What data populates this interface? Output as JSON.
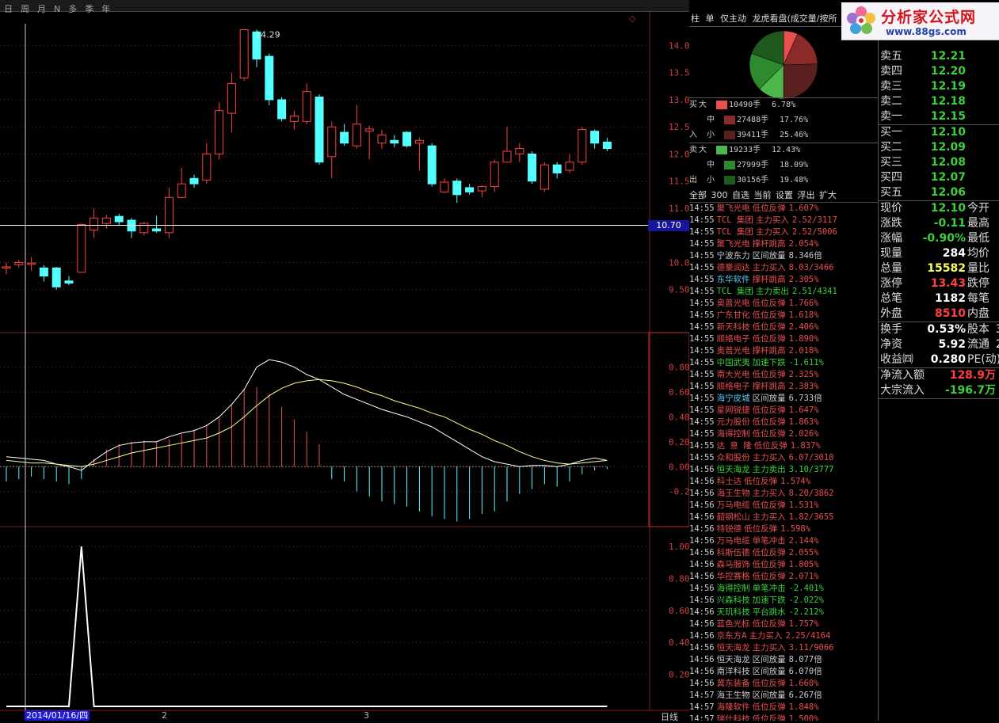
{
  "toolbar": {
    "items": [
      "日",
      "周",
      "月",
      "N",
      "多",
      "季",
      "年"
    ]
  },
  "chart_data": [
    {
      "type": "candlestick",
      "title": "",
      "ylim": [
        9.0,
        14.4
      ],
      "y_ticks": [
        "14.00",
        "13.50",
        "13.00",
        "12.50",
        "12.00",
        "11.50",
        "11.00",
        "10.00",
        "9.50"
      ],
      "high_label": "14.29",
      "current_price_label": "10.70",
      "candles": [
        {
          "o": 9.9,
          "c": 9.92,
          "h": 10.0,
          "l": 9.78
        },
        {
          "o": 9.96,
          "c": 10.0,
          "h": 10.05,
          "l": 9.9
        },
        {
          "o": 9.98,
          "c": 9.99,
          "h": 10.1,
          "l": 9.85
        },
        {
          "o": 9.9,
          "c": 9.75,
          "h": 9.95,
          "l": 9.65
        },
        {
          "o": 9.9,
          "c": 9.55,
          "h": 9.92,
          "l": 9.5
        },
        {
          "o": 9.66,
          "c": 9.62,
          "h": 9.75,
          "l": 9.58
        },
        {
          "o": 9.82,
          "c": 10.7,
          "h": 10.72,
          "l": 9.82
        },
        {
          "o": 10.6,
          "c": 10.82,
          "h": 11.0,
          "l": 10.45
        },
        {
          "o": 10.72,
          "c": 10.82,
          "h": 10.88,
          "l": 10.62
        },
        {
          "o": 10.85,
          "c": 10.75,
          "h": 10.9,
          "l": 10.68
        },
        {
          "o": 10.78,
          "c": 10.58,
          "h": 10.82,
          "l": 10.45
        },
        {
          "o": 10.55,
          "c": 10.72,
          "h": 10.75,
          "l": 10.5
        },
        {
          "o": 10.62,
          "c": 10.58,
          "h": 10.86,
          "l": 10.55
        },
        {
          "o": 10.55,
          "c": 11.2,
          "h": 11.38,
          "l": 10.45
        },
        {
          "o": 11.2,
          "c": 11.45,
          "h": 11.75,
          "l": 11.18
        },
        {
          "o": 11.55,
          "c": 11.45,
          "h": 11.62,
          "l": 11.38
        },
        {
          "o": 11.52,
          "c": 12.0,
          "h": 12.2,
          "l": 11.45
        },
        {
          "o": 12.0,
          "c": 12.8,
          "h": 12.95,
          "l": 11.9
        },
        {
          "o": 12.75,
          "c": 13.3,
          "h": 13.5,
          "l": 12.4
        },
        {
          "o": 13.4,
          "c": 14.29,
          "h": 14.29,
          "l": 13.35
        },
        {
          "o": 14.25,
          "c": 13.75,
          "h": 14.29,
          "l": 13.6
        },
        {
          "o": 13.8,
          "c": 13.0,
          "h": 13.85,
          "l": 12.9
        },
        {
          "o": 13.0,
          "c": 12.65,
          "h": 13.05,
          "l": 12.6
        },
        {
          "o": 12.6,
          "c": 12.7,
          "h": 12.8,
          "l": 12.45
        },
        {
          "o": 12.6,
          "c": 13.15,
          "h": 13.3,
          "l": 12.55
        },
        {
          "o": 13.05,
          "c": 11.85,
          "h": 13.1,
          "l": 11.8
        },
        {
          "o": 11.95,
          "c": 12.5,
          "h": 12.6,
          "l": 11.55
        },
        {
          "o": 12.4,
          "c": 12.2,
          "h": 12.55,
          "l": 12.15
        },
        {
          "o": 12.15,
          "c": 12.55,
          "h": 12.9,
          "l": 12.1
        },
        {
          "o": 12.42,
          "c": 12.46,
          "h": 12.52,
          "l": 11.9
        },
        {
          "o": 12.2,
          "c": 12.35,
          "h": 12.45,
          "l": 12.1
        },
        {
          "o": 12.25,
          "c": 12.2,
          "h": 12.35,
          "l": 12.12
        },
        {
          "o": 12.4,
          "c": 12.15,
          "h": 12.42,
          "l": 12.12
        },
        {
          "o": 12.2,
          "c": 12.25,
          "h": 12.3,
          "l": 11.7
        },
        {
          "o": 12.15,
          "c": 11.45,
          "h": 12.2,
          "l": 11.4
        },
        {
          "o": 11.3,
          "c": 11.48,
          "h": 11.55,
          "l": 11.28
        },
        {
          "o": 11.5,
          "c": 11.25,
          "h": 11.55,
          "l": 11.1
        },
        {
          "o": 11.38,
          "c": 11.3,
          "h": 11.45,
          "l": 11.25
        },
        {
          "o": 11.32,
          "c": 11.4,
          "h": 11.42,
          "l": 11.2
        },
        {
          "o": 11.4,
          "c": 11.85,
          "h": 11.9,
          "l": 11.3
        },
        {
          "o": 11.85,
          "c": 12.05,
          "h": 12.5,
          "l": 11.85
        },
        {
          "o": 12.0,
          "c": 12.1,
          "h": 12.2,
          "l": 11.85
        },
        {
          "o": 12.0,
          "c": 11.5,
          "h": 12.05,
          "l": 11.45
        },
        {
          "o": 11.35,
          "c": 11.8,
          "h": 11.85,
          "l": 11.3
        },
        {
          "o": 11.8,
          "c": 11.65,
          "h": 11.85,
          "l": 11.55
        },
        {
          "o": 11.7,
          "c": 11.85,
          "h": 12.0,
          "l": 11.65
        },
        {
          "o": 11.85,
          "c": 12.45,
          "h": 12.5,
          "l": 11.8
        },
        {
          "o": 12.42,
          "c": 12.2,
          "h": 12.45,
          "l": 12.1
        },
        {
          "o": 12.22,
          "c": 12.1,
          "h": 12.3,
          "l": 12.05
        }
      ]
    },
    {
      "type": "line",
      "title": "",
      "ylim": [
        -0.45,
        0.95
      ],
      "y_ticks": [
        "0.80",
        "0.60",
        "0.40",
        "0.20",
        "0.00",
        "-0.20"
      ],
      "series": [
        {
          "values": [
            0.08,
            0.07,
            0.06,
            0.05,
            0.02,
            0.0,
            -0.03,
            0.05,
            0.12,
            0.17,
            0.19,
            0.2,
            0.2,
            0.24,
            0.27,
            0.29,
            0.33,
            0.4,
            0.5,
            0.62,
            0.8,
            0.86,
            0.84,
            0.8,
            0.74,
            0.7,
            0.64,
            0.58,
            0.54,
            0.5,
            0.46,
            0.43,
            0.4,
            0.36,
            0.32,
            0.26,
            0.2,
            0.14,
            0.08,
            0.04,
            0.02,
            0.0,
            0.01,
            0.01,
            0.0,
            0.02,
            0.05,
            0.07,
            0.05
          ]
        },
        {
          "values": [
            0.05,
            0.04,
            0.03,
            0.03,
            0.02,
            0.01,
            0.0,
            0.02,
            0.05,
            0.08,
            0.11,
            0.13,
            0.15,
            0.17,
            0.19,
            0.21,
            0.23,
            0.27,
            0.32,
            0.4,
            0.49,
            0.57,
            0.63,
            0.67,
            0.69,
            0.7,
            0.69,
            0.67,
            0.64,
            0.6,
            0.57,
            0.53,
            0.5,
            0.47,
            0.43,
            0.4,
            0.35,
            0.3,
            0.26,
            0.21,
            0.17,
            0.12,
            0.08,
            0.05,
            0.03,
            0.02,
            0.03,
            0.04,
            0.05
          ]
        }
      ],
      "bars": [
        -0.12,
        -0.1,
        -0.08,
        -0.1,
        -0.12,
        -0.14,
        -0.1,
        0.06,
        0.14,
        0.18,
        0.2,
        0.21,
        0.2,
        0.22,
        0.26,
        0.3,
        0.34,
        0.4,
        0.5,
        0.62,
        0.64,
        0.58,
        0.48,
        0.38,
        0.28,
        0.18,
        -0.1,
        -0.12,
        -0.2,
        -0.24,
        -0.28,
        -0.3,
        -0.32,
        -0.36,
        -0.4,
        -0.42,
        -0.44,
        -0.42,
        -0.38,
        -0.36,
        -0.28,
        -0.22,
        -0.18,
        -0.14,
        -0.16,
        -0.12,
        -0.06,
        -0.03,
        -0.02
      ]
    },
    {
      "type": "line",
      "title": "",
      "ylim": [
        0,
        1.05
      ],
      "y_ticks": [
        "1.00",
        "0.80",
        "0.60",
        "0.40",
        "0.20"
      ],
      "series": [
        {
          "values": [
            0,
            0,
            0,
            0,
            0,
            0,
            1,
            0,
            0,
            0,
            0,
            0,
            0,
            0,
            0,
            0,
            0,
            0,
            0,
            0,
            0,
            0,
            0,
            0,
            0,
            0,
            0,
            0,
            0,
            0,
            0,
            0,
            0,
            0,
            0,
            0,
            0,
            0,
            0,
            0,
            0,
            0,
            0,
            0,
            0,
            0,
            0,
            0,
            0
          ]
        }
      ]
    }
  ],
  "x_axis": {
    "date": "2014/01/16/四",
    "ticks": [
      "2",
      "3"
    ],
    "period": "日线"
  },
  "panel_tabs": [
    "柱",
    "单",
    "仅主动",
    "龙虎看盘(成交量/按所"
  ],
  "flow": {
    "buy_label": [
      "买",
      "入"
    ],
    "sell_label": [
      "卖",
      "出"
    ],
    "buy": [
      {
        "size": "大",
        "hands": "10490手",
        "pct": "6.78%",
        "color": "#e85050"
      },
      {
        "size": "中",
        "hands": "27488手",
        "pct": "17.76%",
        "color": "#8a2a2a"
      },
      {
        "size": "小",
        "hands": "39411手",
        "pct": "25.46%",
        "color": "#5a2020"
      }
    ],
    "sell": [
      {
        "size": "大",
        "hands": "19233手",
        "pct": "12.43%",
        "color": "#4cb84c"
      },
      {
        "size": "中",
        "hands": "27999手",
        "pct": "18.09%",
        "color": "#2e8a2e"
      },
      {
        "size": "小",
        "hands": "30156手",
        "pct": "19.48%",
        "color": "#1e5a1e"
      }
    ]
  },
  "radar_tools": [
    "全部",
    "300",
    "自选",
    "当前",
    "设置",
    "浮出",
    "扩大"
  ],
  "radar": [
    {
      "t": "14:55",
      "n": "聚飞光电",
      "e": "低位反弹",
      "v": "1.607%",
      "c": "#e85050",
      "nc": "#e85050"
    },
    {
      "t": "14:55",
      "n": "TCL 集团",
      "e": "主力买入",
      "v": "2.52/3117",
      "c": "#e85050",
      "nc": "#e85050"
    },
    {
      "t": "14:55",
      "n": "TCL 集团",
      "e": "主力买入",
      "v": "2.52/5006",
      "c": "#e85050",
      "nc": "#e85050"
    },
    {
      "t": "14:55",
      "n": "聚飞光电",
      "e": "撑杆跳高",
      "v": "2.054%",
      "c": "#e85050",
      "nc": "#e85050"
    },
    {
      "t": "14:55",
      "n": "宁波东力",
      "e": "区间放量",
      "v": "8.346倍",
      "c": "#cccccc",
      "nc": "#cccccc"
    },
    {
      "t": "14:55",
      "n": "德豪润达",
      "e": "主力买入",
      "v": "8.03/3466",
      "c": "#e85050",
      "nc": "#e85050"
    },
    {
      "t": "14:55",
      "n": "东华软件",
      "e": "撑杆跳高",
      "v": "2.305%",
      "c": "#e85050",
      "nc": "#5ac8f0"
    },
    {
      "t": "14:55",
      "n": "TCL 集团",
      "e": "主力卖出",
      "v": "2.51/4341",
      "c": "#3cd03c",
      "nc": "#3cd03c"
    },
    {
      "t": "14:55",
      "n": "奥普光电",
      "e": "低位反弹",
      "v": "1.766%",
      "c": "#e85050",
      "nc": "#e85050"
    },
    {
      "t": "14:55",
      "n": "广东甘化",
      "e": "低位反弹",
      "v": "1.618%",
      "c": "#e85050",
      "nc": "#e85050"
    },
    {
      "t": "14:55",
      "n": "新天科技",
      "e": "低位反弹",
      "v": "2.406%",
      "c": "#e85050",
      "nc": "#e85050"
    },
    {
      "t": "14:55",
      "n": "顺络电子",
      "e": "低位反弹",
      "v": "1.890%",
      "c": "#e85050",
      "nc": "#e85050"
    },
    {
      "t": "14:55",
      "n": "奥普光电",
      "e": "撑杆跳高",
      "v": "2.018%",
      "c": "#e85050",
      "nc": "#e85050"
    },
    {
      "t": "14:55",
      "n": "中国武夷",
      "e": "加速下跌",
      "v": "-1.611%",
      "c": "#3cd03c",
      "nc": "#3cd03c"
    },
    {
      "t": "14:55",
      "n": "南大光电",
      "e": "低位反弹",
      "v": "2.325%",
      "c": "#e85050",
      "nc": "#e85050"
    },
    {
      "t": "14:55",
      "n": "顺络电子",
      "e": "撑杆跳高",
      "v": "2.383%",
      "c": "#e85050",
      "nc": "#e85050"
    },
    {
      "t": "14:55",
      "n": "海宁皮城",
      "e": "区间放量",
      "v": "6.733倍",
      "c": "#cccccc",
      "nc": "#5ac8f0"
    },
    {
      "t": "14:55",
      "n": "星网锐捷",
      "e": "低位反弹",
      "v": "1.647%",
      "c": "#e85050",
      "nc": "#e85050"
    },
    {
      "t": "14:55",
      "n": "元力股份",
      "e": "低位反弹",
      "v": "1.863%",
      "c": "#e85050",
      "nc": "#e85050"
    },
    {
      "t": "14:55",
      "n": "海得控制",
      "e": "低位反弹",
      "v": "2.026%",
      "c": "#e85050",
      "nc": "#e85050"
    },
    {
      "t": "14:55",
      "n": "达 意 隆",
      "e": "低位反弹",
      "v": "1.837%",
      "c": "#e85050",
      "nc": "#e85050"
    },
    {
      "t": "14:55",
      "n": "众和股份",
      "e": "主力买入",
      "v": "6.07/3010",
      "c": "#e85050",
      "nc": "#e85050"
    },
    {
      "t": "14:56",
      "n": "恒天海龙",
      "e": "主力卖出",
      "v": "3.10/3777",
      "c": "#3cd03c",
      "nc": "#3cd03c"
    },
    {
      "t": "14:56",
      "n": "科士达",
      "e": "低位反弹",
      "v": "1.574%",
      "c": "#e85050",
      "nc": "#e85050"
    },
    {
      "t": "14:56",
      "n": "海王生物",
      "e": "主力买入",
      "v": "8.20/3862",
      "c": "#e85050",
      "nc": "#e85050"
    },
    {
      "t": "14:56",
      "n": "万马电缆",
      "e": "低位反弹",
      "v": "1.531%",
      "c": "#e85050",
      "nc": "#e85050"
    },
    {
      "t": "14:56",
      "n": "韶钢松山",
      "e": "主力买入",
      "v": "1.82/3655",
      "c": "#e85050",
      "nc": "#e85050"
    },
    {
      "t": "14:56",
      "n": "特锐德",
      "e": "低位反弹",
      "v": "1.598%",
      "c": "#e85050",
      "nc": "#e85050"
    },
    {
      "t": "14:56",
      "n": "万马电缆",
      "e": "单笔冲击",
      "v": "2.144%",
      "c": "#e85050",
      "nc": "#e85050"
    },
    {
      "t": "14:56",
      "n": "科斯伍德",
      "e": "低位反弹",
      "v": "2.055%",
      "c": "#e85050",
      "nc": "#e85050"
    },
    {
      "t": "14:56",
      "n": "森马服饰",
      "e": "低位反弹",
      "v": "1.805%",
      "c": "#e85050",
      "nc": "#e85050"
    },
    {
      "t": "14:56",
      "n": "华控赛格",
      "e": "低位反弹",
      "v": "2.071%",
      "c": "#e85050",
      "nc": "#e85050"
    },
    {
      "t": "14:56",
      "n": "海得控制",
      "e": "单笔冲击",
      "v": "-2.401%",
      "c": "#3cd03c",
      "nc": "#3cd03c"
    },
    {
      "t": "14:56",
      "n": "兴森科技",
      "e": "加速下跌",
      "v": "-2.022%",
      "c": "#3cd03c",
      "nc": "#3cd03c"
    },
    {
      "t": "14:56",
      "n": "天玑科技",
      "e": "平台跳水",
      "v": "-2.212%",
      "c": "#3cd03c",
      "nc": "#3cd03c"
    },
    {
      "t": "14:56",
      "n": "蓝色光标",
      "e": "低位反弹",
      "v": "1.757%",
      "c": "#e85050",
      "nc": "#e85050"
    },
    {
      "t": "14:56",
      "n": "京东方A",
      "e": "主力买入",
      "v": "2.25/4164",
      "c": "#e85050",
      "nc": "#e85050"
    },
    {
      "t": "14:56",
      "n": "恒天海龙",
      "e": "主力买入",
      "v": "3.11/9066",
      "c": "#e85050",
      "nc": "#e85050"
    },
    {
      "t": "14:56",
      "n": "恒天海龙",
      "e": "区间放量",
      "v": "8.077倍",
      "c": "#cccccc",
      "nc": "#cccccc"
    },
    {
      "t": "14:56",
      "n": "南洋科技",
      "e": "区间放量",
      "v": "6.070倍",
      "c": "#cccccc",
      "nc": "#cccccc"
    },
    {
      "t": "14:56",
      "n": "冀东装备",
      "e": "低位反弹",
      "v": "1.660%",
      "c": "#e85050",
      "nc": "#e85050"
    },
    {
      "t": "14:57",
      "n": "海王生物",
      "e": "区间放量",
      "v": "6.267倍",
      "c": "#cccccc",
      "nc": "#cccccc"
    },
    {
      "t": "14:57",
      "n": "海隆软件",
      "e": "低位反弹",
      "v": "1.848%",
      "c": "#e85050",
      "nc": "#e85050"
    },
    {
      "t": "14:57",
      "n": "瑞仕科技",
      "e": "低位反弹",
      "v": "1.500%",
      "c": "#e85050",
      "nc": "#e85050"
    }
  ],
  "quote": {
    "asks": [
      {
        "k": "卖五",
        "v": "12.21"
      },
      {
        "k": "卖四",
        "v": "12.20"
      },
      {
        "k": "卖三",
        "v": "12.19"
      },
      {
        "k": "卖二",
        "v": "12.18"
      },
      {
        "k": "卖一",
        "v": "12.15"
      }
    ],
    "bids": [
      {
        "k": "买一",
        "v": "12.10"
      },
      {
        "k": "买二",
        "v": "12.09"
      },
      {
        "k": "买三",
        "v": "12.08"
      },
      {
        "k": "买四",
        "v": "12.07"
      },
      {
        "k": "买五",
        "v": "12.06"
      }
    ],
    "stats": [
      {
        "k": "现价",
        "v": "12.10",
        "c": "#3cd03c",
        "k2": "今开"
      },
      {
        "k": "涨跌",
        "v": "-0.11",
        "c": "#3cd03c",
        "k2": "最高"
      },
      {
        "k": "涨幅",
        "v": "-0.90%",
        "c": "#3cd03c",
        "k2": "最低"
      },
      {
        "k": "现量",
        "v": "284",
        "c": "#ffffff",
        "k2": "均价"
      },
      {
        "k": "总量",
        "v": "15582",
        "c": "#ffff60",
        "k2": "量比"
      },
      {
        "k": "涨停",
        "v": "13.43",
        "c": "#ff4040",
        "k2": "跌停"
      },
      {
        "k": "总笔",
        "v": "1182",
        "c": "#ffffff",
        "k2": "每笔"
      },
      {
        "k": "外盘",
        "v": "8510",
        "c": "#ff4040",
        "k2": "内盘"
      }
    ],
    "stats2": [
      {
        "k": "换手",
        "v": "0.53%",
        "c": "#ffffff",
        "k2": "股本",
        "v2": "3"
      },
      {
        "k": "净资",
        "v": "5.92",
        "c": "#ffffff",
        "k2": "流通",
        "v2": "2"
      },
      {
        "k": "收益㈣",
        "v": "0.280",
        "c": "#ffffff",
        "k2": "PE(动)",
        "v2": ""
      }
    ],
    "flows": [
      {
        "k": "净流入额",
        "v": "128.9万",
        "c": "#ff4040"
      },
      {
        "k": "大宗流入",
        "v": "-196.7万",
        "c": "#3cd03c"
      }
    ]
  },
  "logo": {
    "title": "分析家公式网",
    "url": "www.88gs.com"
  },
  "colors": {
    "up": "#ff4040",
    "down": "#54ffff",
    "grid": "#8a1a1a",
    "macd_line": "#ffffff",
    "macd_signal": "#ffff90"
  }
}
